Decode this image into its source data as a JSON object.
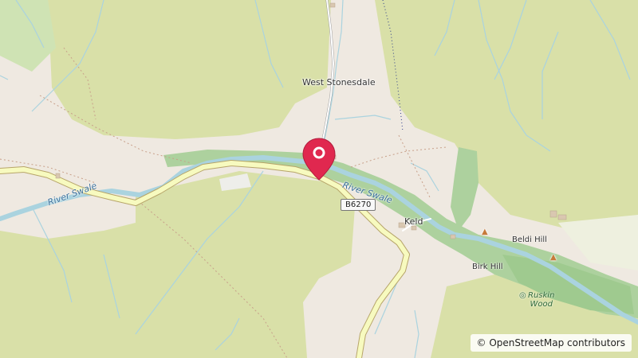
{
  "map": {
    "places": {
      "west_stonesdale": "West Stonesdale",
      "keld": "Keld",
      "beldi_hill": "Beldi Hill",
      "birk_hill": "Birk Hill",
      "ruskin_wood_line1": "Ruskin",
      "ruskin_wood_line2": "Wood"
    },
    "rivers": {
      "west": "River Swale",
      "east": "River Swale"
    },
    "road_ref": "B6270",
    "attribution": "© OpenStreetMap contributors",
    "marker_color": "#e0284f",
    "colors": {
      "background": "#efe9e1",
      "moorland": "#d9e0a8",
      "woodland": "#add19e",
      "water": "#aad3df",
      "road": "#f7fabf"
    }
  }
}
